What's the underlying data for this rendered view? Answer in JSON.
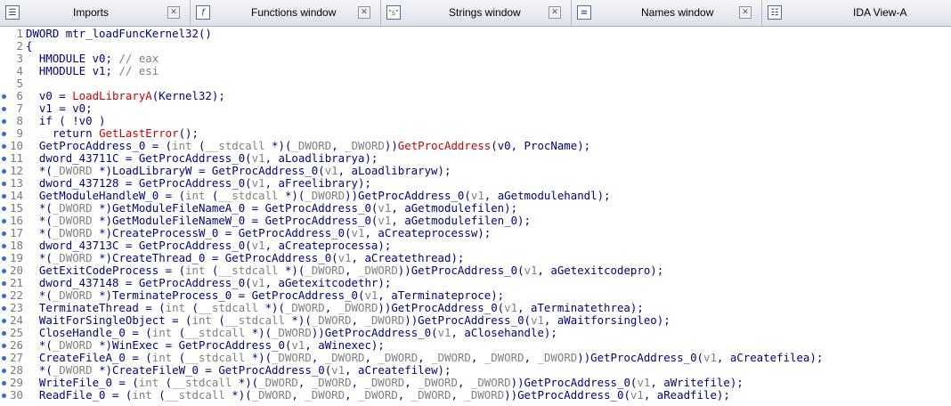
{
  "tabs": [
    {
      "label": "Imports",
      "icon": "imports-icon",
      "glyph": "☰"
    },
    {
      "label": "Functions window",
      "icon": "function-icon",
      "glyph": "f"
    },
    {
      "label": "Strings window",
      "icon": "strings-icon",
      "glyph": "\"s\""
    },
    {
      "label": "Names window",
      "icon": "names-icon",
      "glyph": "≡"
    },
    {
      "label": "IDA View-A",
      "icon": "ida-view-icon",
      "glyph": "☷"
    }
  ],
  "close_glyph": "✕",
  "colors": {
    "plain": "#000080",
    "comment": "#808080",
    "api_call": "#cc0000",
    "variable": "#808080",
    "line_number": "#7a7a7a",
    "gutter_dot": "#2a6fd1"
  },
  "code_lines": [
    {
      "num": "1",
      "dot": false,
      "segments": [
        {
          "t": "DWORD mtr_loadFuncKernel32()",
          "k": "plain"
        }
      ]
    },
    {
      "num": "2",
      "dot": false,
      "segments": [
        {
          "t": "{",
          "k": "plain"
        }
      ]
    },
    {
      "num": "3",
      "dot": false,
      "segments": [
        {
          "t": "  HMODULE v0; ",
          "k": "plain"
        },
        {
          "t": "// eax",
          "k": "comment"
        }
      ]
    },
    {
      "num": "4",
      "dot": false,
      "segments": [
        {
          "t": "  HMODULE v1; ",
          "k": "plain"
        },
        {
          "t": "// esi",
          "k": "comment"
        }
      ]
    },
    {
      "num": "5",
      "dot": false,
      "segments": [
        {
          "t": "",
          "k": "plain"
        }
      ]
    },
    {
      "num": "6",
      "dot": true,
      "segments": [
        {
          "t": "  v0 = ",
          "k": "plain"
        },
        {
          "t": "LoadLibraryA",
          "k": "api_call"
        },
        {
          "t": "(Kernel32);",
          "k": "plain"
        }
      ]
    },
    {
      "num": "7",
      "dot": true,
      "segments": [
        {
          "t": "  v1 = v0;",
          "k": "plain"
        }
      ]
    },
    {
      "num": "8",
      "dot": true,
      "segments": [
        {
          "t": "  if ( !v0 )",
          "k": "plain"
        }
      ]
    },
    {
      "num": "9",
      "dot": true,
      "segments": [
        {
          "t": "    return ",
          "k": "plain"
        },
        {
          "t": "GetLastError",
          "k": "api_call"
        },
        {
          "t": "();",
          "k": "plain"
        }
      ]
    },
    {
      "num": "10",
      "dot": true,
      "segments": [
        {
          "t": "  GetProcAddress_0 = (",
          "k": "plain"
        },
        {
          "t": "int",
          "k": "variable"
        },
        {
          "t": " (",
          "k": "plain"
        },
        {
          "t": "__stdcall",
          "k": "variable"
        },
        {
          "t": " *)(",
          "k": "plain"
        },
        {
          "t": "_DWORD",
          "k": "variable"
        },
        {
          "t": ", ",
          "k": "plain"
        },
        {
          "t": "_DWORD",
          "k": "variable"
        },
        {
          "t": "))",
          "k": "plain"
        },
        {
          "t": "GetProcAddress",
          "k": "api_call"
        },
        {
          "t": "(v0, ProcName);",
          "k": "plain"
        }
      ]
    },
    {
      "num": "11",
      "dot": true,
      "segments": [
        {
          "t": "  dword_43711C = GetProcAddress_0(",
          "k": "plain"
        },
        {
          "t": "v1",
          "k": "variable"
        },
        {
          "t": ", aLoadlibrarya);",
          "k": "plain"
        }
      ]
    },
    {
      "num": "12",
      "dot": true,
      "segments": [
        {
          "t": "  *(",
          "k": "plain"
        },
        {
          "t": "_DWORD",
          "k": "variable"
        },
        {
          "t": " *)LoadLibraryW = GetProcAddress_0(",
          "k": "plain"
        },
        {
          "t": "v1",
          "k": "variable"
        },
        {
          "t": ", aLoadlibraryw);",
          "k": "plain"
        }
      ]
    },
    {
      "num": "13",
      "dot": true,
      "segments": [
        {
          "t": "  dword_437128 = GetProcAddress_0(",
          "k": "plain"
        },
        {
          "t": "v1",
          "k": "variable"
        },
        {
          "t": ", aFreelibrary);",
          "k": "plain"
        }
      ]
    },
    {
      "num": "14",
      "dot": true,
      "segments": [
        {
          "t": "  GetModuleHandleW_0 = (",
          "k": "plain"
        },
        {
          "t": "int",
          "k": "variable"
        },
        {
          "t": " (",
          "k": "plain"
        },
        {
          "t": "__stdcall",
          "k": "variable"
        },
        {
          "t": " *)(",
          "k": "plain"
        },
        {
          "t": "_DWORD",
          "k": "variable"
        },
        {
          "t": "))GetProcAddress_0(",
          "k": "plain"
        },
        {
          "t": "v1",
          "k": "variable"
        },
        {
          "t": ", aGetmodulehandl);",
          "k": "plain"
        }
      ]
    },
    {
      "num": "15",
      "dot": true,
      "segments": [
        {
          "t": "  *(",
          "k": "plain"
        },
        {
          "t": "_DWORD",
          "k": "variable"
        },
        {
          "t": " *)GetModuleFileNameA_0 = GetProcAddress_0(",
          "k": "plain"
        },
        {
          "t": "v1",
          "k": "variable"
        },
        {
          "t": ", aGetmodulefilen);",
          "k": "plain"
        }
      ]
    },
    {
      "num": "16",
      "dot": true,
      "segments": [
        {
          "t": "  *(",
          "k": "plain"
        },
        {
          "t": "_DWORD",
          "k": "variable"
        },
        {
          "t": " *)GetModuleFileNameW_0 = GetProcAddress_0(",
          "k": "plain"
        },
        {
          "t": "v1",
          "k": "variable"
        },
        {
          "t": ", aGetmodulefilen_0);",
          "k": "plain"
        }
      ]
    },
    {
      "num": "17",
      "dot": true,
      "segments": [
        {
          "t": "  *(",
          "k": "plain"
        },
        {
          "t": "_DWORD",
          "k": "variable"
        },
        {
          "t": " *)CreateProcessW_0 = GetProcAddress_0(",
          "k": "plain"
        },
        {
          "t": "v1",
          "k": "variable"
        },
        {
          "t": ", aCreateprocessw);",
          "k": "plain"
        }
      ]
    },
    {
      "num": "18",
      "dot": true,
      "segments": [
        {
          "t": "  dword_43713C = GetProcAddress_0(",
          "k": "plain"
        },
        {
          "t": "v1",
          "k": "variable"
        },
        {
          "t": ", aCreateprocessa);",
          "k": "plain"
        }
      ]
    },
    {
      "num": "19",
      "dot": true,
      "segments": [
        {
          "t": "  *(",
          "k": "plain"
        },
        {
          "t": "_DWORD",
          "k": "variable"
        },
        {
          "t": " *)CreateThread_0 = GetProcAddress_0(",
          "k": "plain"
        },
        {
          "t": "v1",
          "k": "variable"
        },
        {
          "t": ", aCreatethread);",
          "k": "plain"
        }
      ]
    },
    {
      "num": "20",
      "dot": true,
      "segments": [
        {
          "t": "  GetExitCodeProcess = (",
          "k": "plain"
        },
        {
          "t": "int",
          "k": "variable"
        },
        {
          "t": " (",
          "k": "plain"
        },
        {
          "t": "__stdcall",
          "k": "variable"
        },
        {
          "t": " *)(",
          "k": "plain"
        },
        {
          "t": "_DWORD",
          "k": "variable"
        },
        {
          "t": ", ",
          "k": "plain"
        },
        {
          "t": "_DWORD",
          "k": "variable"
        },
        {
          "t": "))GetProcAddress_0(",
          "k": "plain"
        },
        {
          "t": "v1",
          "k": "variable"
        },
        {
          "t": ", aGetexitcodepro);",
          "k": "plain"
        }
      ]
    },
    {
      "num": "21",
      "dot": true,
      "segments": [
        {
          "t": "  dword_437148 = GetProcAddress_0(",
          "k": "plain"
        },
        {
          "t": "v1",
          "k": "variable"
        },
        {
          "t": ", aGetexitcodethr);",
          "k": "plain"
        }
      ]
    },
    {
      "num": "22",
      "dot": true,
      "segments": [
        {
          "t": "  *(",
          "k": "plain"
        },
        {
          "t": "_DWORD",
          "k": "variable"
        },
        {
          "t": " *)TerminateProcess_0 = GetProcAddress_0(",
          "k": "plain"
        },
        {
          "t": "v1",
          "k": "variable"
        },
        {
          "t": ", aTerminateproce);",
          "k": "plain"
        }
      ]
    },
    {
      "num": "23",
      "dot": true,
      "segments": [
        {
          "t": "  TerminateThread = (",
          "k": "plain"
        },
        {
          "t": "int",
          "k": "variable"
        },
        {
          "t": " (",
          "k": "plain"
        },
        {
          "t": "__stdcall",
          "k": "variable"
        },
        {
          "t": " *)(",
          "k": "plain"
        },
        {
          "t": "_DWORD",
          "k": "variable"
        },
        {
          "t": ", ",
          "k": "plain"
        },
        {
          "t": "_DWORD",
          "k": "variable"
        },
        {
          "t": "))GetProcAddress_0(",
          "k": "plain"
        },
        {
          "t": "v1",
          "k": "variable"
        },
        {
          "t": ", aTerminatethrea);",
          "k": "plain"
        }
      ]
    },
    {
      "num": "24",
      "dot": true,
      "segments": [
        {
          "t": "  WaitForSingleObject = (",
          "k": "plain"
        },
        {
          "t": "int",
          "k": "variable"
        },
        {
          "t": " (",
          "k": "plain"
        },
        {
          "t": "__stdcall",
          "k": "variable"
        },
        {
          "t": " *)(",
          "k": "plain"
        },
        {
          "t": "_DWORD",
          "k": "variable"
        },
        {
          "t": ", ",
          "k": "plain"
        },
        {
          "t": "_DWORD",
          "k": "variable"
        },
        {
          "t": "))GetProcAddress_0(",
          "k": "plain"
        },
        {
          "t": "v1",
          "k": "variable"
        },
        {
          "t": ", aWaitforsingleo);",
          "k": "plain"
        }
      ]
    },
    {
      "num": "25",
      "dot": true,
      "segments": [
        {
          "t": "  CloseHandle_0 = (",
          "k": "plain"
        },
        {
          "t": "int",
          "k": "variable"
        },
        {
          "t": " (",
          "k": "plain"
        },
        {
          "t": "__stdcall",
          "k": "variable"
        },
        {
          "t": " *)(",
          "k": "plain"
        },
        {
          "t": "_DWORD",
          "k": "variable"
        },
        {
          "t": "))GetProcAddress_0(",
          "k": "plain"
        },
        {
          "t": "v1",
          "k": "variable"
        },
        {
          "t": ", aClosehandle);",
          "k": "plain"
        }
      ]
    },
    {
      "num": "26",
      "dot": true,
      "segments": [
        {
          "t": "  *(",
          "k": "plain"
        },
        {
          "t": "_DWORD",
          "k": "variable"
        },
        {
          "t": " *)WinExec = GetProcAddress_0(",
          "k": "plain"
        },
        {
          "t": "v1",
          "k": "variable"
        },
        {
          "t": ", aWinexec);",
          "k": "plain"
        }
      ]
    },
    {
      "num": "27",
      "dot": true,
      "segments": [
        {
          "t": "  CreateFileA_0 = (",
          "k": "plain"
        },
        {
          "t": "int",
          "k": "variable"
        },
        {
          "t": " (",
          "k": "plain"
        },
        {
          "t": "__stdcall",
          "k": "variable"
        },
        {
          "t": " *)(",
          "k": "plain"
        },
        {
          "t": "_DWORD",
          "k": "variable"
        },
        {
          "t": ", ",
          "k": "plain"
        },
        {
          "t": "_DWORD",
          "k": "variable"
        },
        {
          "t": ", ",
          "k": "plain"
        },
        {
          "t": "_DWORD",
          "k": "variable"
        },
        {
          "t": ", ",
          "k": "plain"
        },
        {
          "t": "_DWORD",
          "k": "variable"
        },
        {
          "t": ", ",
          "k": "plain"
        },
        {
          "t": "_DWORD",
          "k": "variable"
        },
        {
          "t": ", ",
          "k": "plain"
        },
        {
          "t": "_DWORD",
          "k": "variable"
        },
        {
          "t": "))GetProcAddress_0(",
          "k": "plain"
        },
        {
          "t": "v1",
          "k": "variable"
        },
        {
          "t": ", aCreatefilea);",
          "k": "plain"
        }
      ]
    },
    {
      "num": "28",
      "dot": true,
      "segments": [
        {
          "t": "  *(",
          "k": "plain"
        },
        {
          "t": "_DWORD",
          "k": "variable"
        },
        {
          "t": " *)CreateFileW_0 = GetProcAddress_0(",
          "k": "plain"
        },
        {
          "t": "v1",
          "k": "variable"
        },
        {
          "t": ", aCreatefilew);",
          "k": "plain"
        }
      ]
    },
    {
      "num": "29",
      "dot": true,
      "segments": [
        {
          "t": "  WriteFile_0 = (",
          "k": "plain"
        },
        {
          "t": "int",
          "k": "variable"
        },
        {
          "t": " (",
          "k": "plain"
        },
        {
          "t": "__stdcall",
          "k": "variable"
        },
        {
          "t": " *)(",
          "k": "plain"
        },
        {
          "t": "_DWORD",
          "k": "variable"
        },
        {
          "t": ", ",
          "k": "plain"
        },
        {
          "t": "_DWORD",
          "k": "variable"
        },
        {
          "t": ", ",
          "k": "plain"
        },
        {
          "t": "_DWORD",
          "k": "variable"
        },
        {
          "t": ", ",
          "k": "plain"
        },
        {
          "t": "_DWORD",
          "k": "variable"
        },
        {
          "t": ", ",
          "k": "plain"
        },
        {
          "t": "_DWORD",
          "k": "variable"
        },
        {
          "t": "))GetProcAddress_0(",
          "k": "plain"
        },
        {
          "t": "v1",
          "k": "variable"
        },
        {
          "t": ", aWritefile);",
          "k": "plain"
        }
      ]
    },
    {
      "num": "30",
      "dot": true,
      "segments": [
        {
          "t": "  ReadFile_0 = (",
          "k": "plain"
        },
        {
          "t": "int",
          "k": "variable"
        },
        {
          "t": " (",
          "k": "plain"
        },
        {
          "t": "__stdcall",
          "k": "variable"
        },
        {
          "t": " *)(",
          "k": "plain"
        },
        {
          "t": "_DWORD",
          "k": "variable"
        },
        {
          "t": ", ",
          "k": "plain"
        },
        {
          "t": "_DWORD",
          "k": "variable"
        },
        {
          "t": ", ",
          "k": "plain"
        },
        {
          "t": "_DWORD",
          "k": "variable"
        },
        {
          "t": ", ",
          "k": "plain"
        },
        {
          "t": "_DWORD",
          "k": "variable"
        },
        {
          "t": ", ",
          "k": "plain"
        },
        {
          "t": "_DWORD",
          "k": "variable"
        },
        {
          "t": "))GetProcAddress_0(",
          "k": "plain"
        },
        {
          "t": "v1",
          "k": "variable"
        },
        {
          "t": ", aReadfile);",
          "k": "plain"
        }
      ]
    }
  ]
}
